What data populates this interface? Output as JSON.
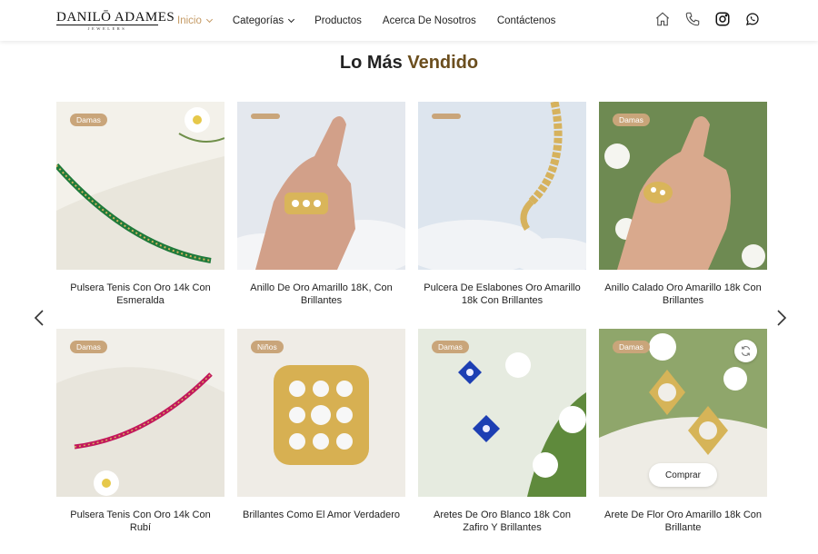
{
  "brand": {
    "name": "DANILŌ ADAMES",
    "subtitle": "JEWELERS"
  },
  "nav": [
    {
      "label": "Inicio",
      "active": true,
      "dropdown": true
    },
    {
      "label": "Categorías",
      "active": false,
      "dropdown": true
    },
    {
      "label": "Productos",
      "active": false,
      "dropdown": false
    },
    {
      "label": "Acerca De Nosotros",
      "active": false,
      "dropdown": false
    },
    {
      "label": "Contáctenos",
      "active": false,
      "dropdown": false
    }
  ],
  "header_icons": [
    "home-icon",
    "phone-icon",
    "instagram-icon",
    "whatsapp-icon"
  ],
  "section": {
    "title_part1": "Lo Más",
    "title_part2": "Vendido"
  },
  "colors": {
    "accent": "#c59a64",
    "badge": "#c9a57a",
    "title_accent": "#6b4e1e"
  },
  "products": [
    {
      "title": "Pulsera Tenis Con Oro 14k Con Esmeralda",
      "badge": "Damas"
    },
    {
      "title": "Anillo De Oro Amarillo 18K, Con Brillantes",
      "badge": ""
    },
    {
      "title": "Pulcera De Eslabones Oro Amarillo 18k Con Brillantes",
      "badge": ""
    },
    {
      "title": "Anillo Calado Oro Amarillo 18k Con Brillantes",
      "badge": "Damas"
    },
    {
      "title": "Pulsera Tenis Con Oro 14k Con Rubí",
      "badge": "Damas"
    },
    {
      "title": "Brillantes Como El Amor Verdadero",
      "badge": "Niños"
    },
    {
      "title": "Aretes De Oro Blanco 18k Con Zafiro Y Brillantes",
      "badge": "Damas"
    },
    {
      "title": "Arete De Flor Oro Amarillo 18k Con Brillante",
      "badge": "Damas",
      "buy_label": "Comprar"
    }
  ]
}
